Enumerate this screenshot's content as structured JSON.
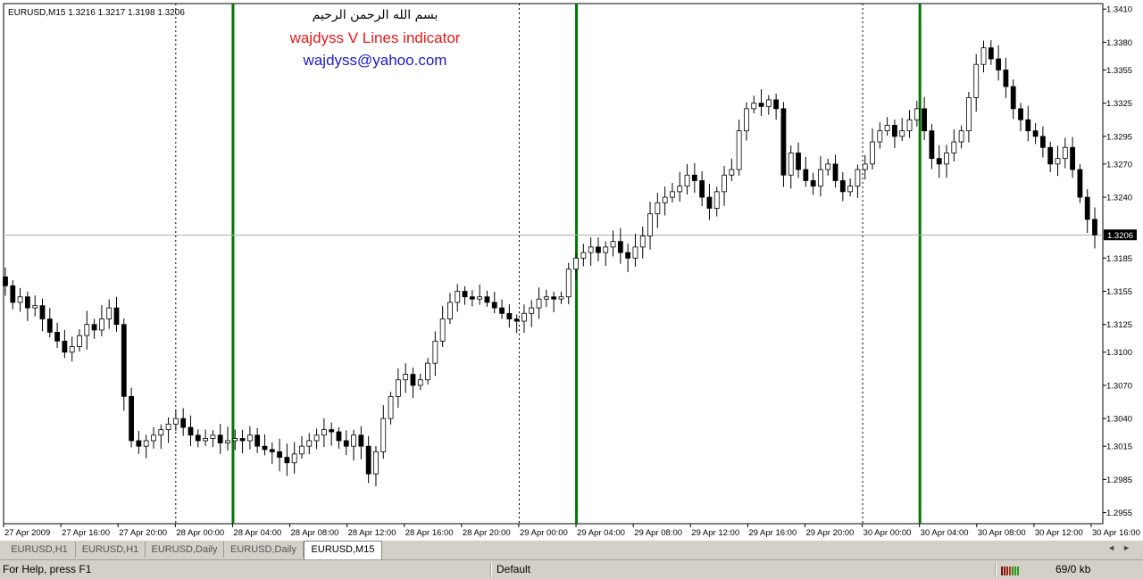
{
  "chart": {
    "symbol_info": "EURUSD,M15  1.3216 1.3217 1.3198 1.3206",
    "arabic_caption": "بسم الله الرحمن الرحيم",
    "indicator_title": "wajdyss V Lines indicator",
    "email": "wajdyss@yahoo.com",
    "current_price_label": "1.3206",
    "price_axis_labels": [
      "1.3410",
      "1.3380",
      "1.3355",
      "1.3325",
      "1.3295",
      "1.3270",
      "1.3240",
      "1.3185",
      "1.3155",
      "1.3125",
      "1.3100",
      "1.3070",
      "1.3040",
      "1.3015",
      "1.2985",
      "1.2955"
    ],
    "time_axis_labels": [
      "27 Apr 2009",
      "27 Apr 16:00",
      "27 Apr 20:00",
      "28 Apr 00:00",
      "28 Apr 04:00",
      "28 Apr 08:00",
      "28 Apr 12:00",
      "28 Apr 16:00",
      "28 Apr 20:00",
      "29 Apr 00:00",
      "29 Apr 04:00",
      "29 Apr 08:00",
      "29 Apr 12:00",
      "29 Apr 16:00",
      "29 Apr 20:00",
      "30 Apr 00:00",
      "30 Apr 04:00",
      "30 Apr 08:00",
      "30 Apr 12:00",
      "30 Apr 16:00"
    ],
    "vline_color": "#007700",
    "daily_separator_times": [
      "28 Apr 00:00",
      "29 Apr 00:00",
      "30 Apr 00:00"
    ],
    "indicator_vline_times": [
      "28 Apr 04:00",
      "29 Apr 04:00",
      "30 Apr 04:00"
    ]
  },
  "chart_data": {
    "type": "candlestick",
    "symbol": "EURUSD",
    "timeframe": "M15",
    "ylim": [
      1.2945,
      1.3415
    ],
    "current_price": 1.3206,
    "close_series_approx": [
      1.316,
      1.3145,
      1.315,
      1.314,
      1.3142,
      1.313,
      1.3118,
      1.311,
      1.31,
      1.3105,
      1.3115,
      1.3125,
      1.312,
      1.313,
      1.314,
      1.3125,
      1.306,
      1.302,
      1.3015,
      1.302,
      1.3025,
      1.303,
      1.3035,
      1.304,
      1.3032,
      1.3025,
      1.302,
      1.3022,
      1.3025,
      1.3018,
      1.302,
      1.3022,
      1.302,
      1.3025,
      1.3015,
      1.3012,
      1.301,
      1.3005,
      1.3,
      1.3008,
      1.3015,
      1.302,
      1.3025,
      1.303,
      1.3028,
      1.302,
      1.3015,
      1.3025,
      1.3015,
      1.299,
      1.301,
      1.304,
      1.306,
      1.3075,
      1.308,
      1.307,
      1.3075,
      1.309,
      1.311,
      1.313,
      1.3145,
      1.3155,
      1.315,
      1.3148,
      1.315,
      1.3145,
      1.314,
      1.3135,
      1.313,
      1.3128,
      1.3135,
      1.314,
      1.3148,
      1.315,
      1.3148,
      1.315,
      1.3175,
      1.3185,
      1.319,
      1.3195,
      1.319,
      1.3195,
      1.32,
      1.319,
      1.3185,
      1.3195,
      1.3205,
      1.3225,
      1.3235,
      1.324,
      1.3245,
      1.325,
      1.326,
      1.3255,
      1.324,
      1.323,
      1.3245,
      1.326,
      1.3265,
      1.33,
      1.332,
      1.3325,
      1.3322,
      1.3328,
      1.332,
      1.326,
      1.328,
      1.3265,
      1.3255,
      1.325,
      1.3265,
      1.327,
      1.3255,
      1.3245,
      1.325,
      1.3265,
      1.327,
      1.329,
      1.33,
      1.3305,
      1.3295,
      1.33,
      1.331,
      1.332,
      1.33,
      1.3275,
      1.327,
      1.328,
      1.329,
      1.33,
      1.333,
      1.336,
      1.3375,
      1.3365,
      1.3355,
      1.334,
      1.332,
      1.331,
      1.33,
      1.3295,
      1.3285,
      1.327,
      1.3275,
      1.3285,
      1.3265,
      1.324,
      1.322,
      1.3206
    ]
  },
  "tabs": [
    {
      "label": "EURUSD,H1",
      "active": false
    },
    {
      "label": "EURUSD,H1",
      "active": false
    },
    {
      "label": "EURUSD,Daily",
      "active": false
    },
    {
      "label": "EURUSD,Daily",
      "active": false
    },
    {
      "label": "EURUSD,M15",
      "active": true
    }
  ],
  "tab_nav": {
    "left": "◄",
    "right": "►"
  },
  "status": {
    "help": "For Help, press F1",
    "profile": "Default",
    "traffic": "69/0 kb"
  }
}
